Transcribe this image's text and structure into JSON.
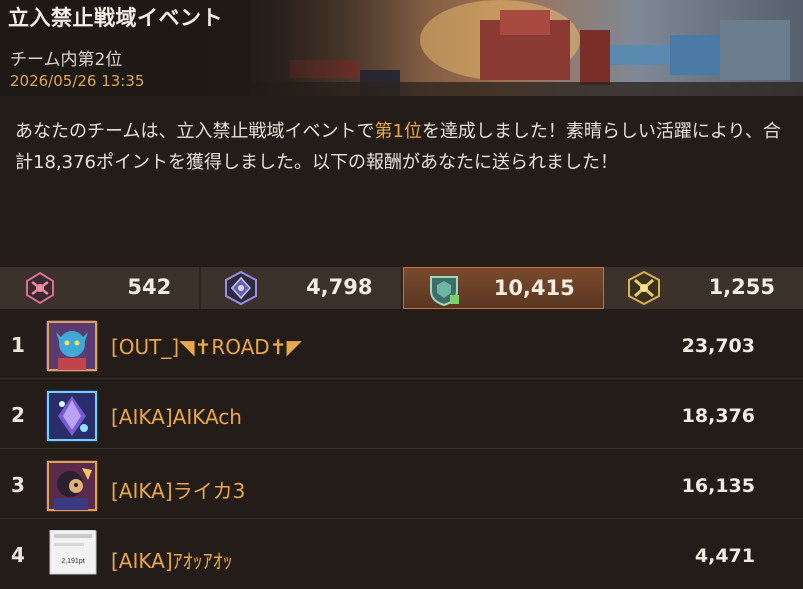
{
  "header": {
    "title": "立入禁止戦域イベント",
    "subtitle": "チーム内第2位",
    "date": "2026/05/26 13:35"
  },
  "message": {
    "part1": "あなたのチームは、立入禁止戦域イベントで",
    "highlight": "第1位",
    "part2": "を達成しました！素晴らしい活躍により、合計18,376ポイントを獲得しました。以下の報酬があなたに送られました！"
  },
  "stats": [
    {
      "icon": "pink-faction-icon",
      "value": "542",
      "color": "#d9718c",
      "active": false
    },
    {
      "icon": "purple-faction-icon",
      "value": "4,798",
      "color": "#8c7fcf",
      "active": false
    },
    {
      "icon": "teal-faction-icon",
      "value": "10,415",
      "color": "#6fb5a5",
      "active": true
    },
    {
      "icon": "gold-faction-icon",
      "value": "1,255",
      "color": "#d9b24a",
      "active": false
    }
  ],
  "ranking": [
    {
      "rank": "1",
      "name": "[OUT_]◥✝ROAD✝◤",
      "score": "23,703",
      "avatar": "avatar-blue-character"
    },
    {
      "rank": "2",
      "name": "[AIKA]AIKAch",
      "score": "18,376",
      "avatar": "avatar-crystal"
    },
    {
      "rank": "3",
      "name": "[AIKA]ライカ3",
      "score": "16,135",
      "avatar": "avatar-dark-character"
    },
    {
      "rank": "4",
      "name": "[AIKA]ｱｵｯｱｵｯ",
      "score": "4,471",
      "avatar": "avatar-screenshot"
    }
  ],
  "avatar4_caption": "2,191pt"
}
